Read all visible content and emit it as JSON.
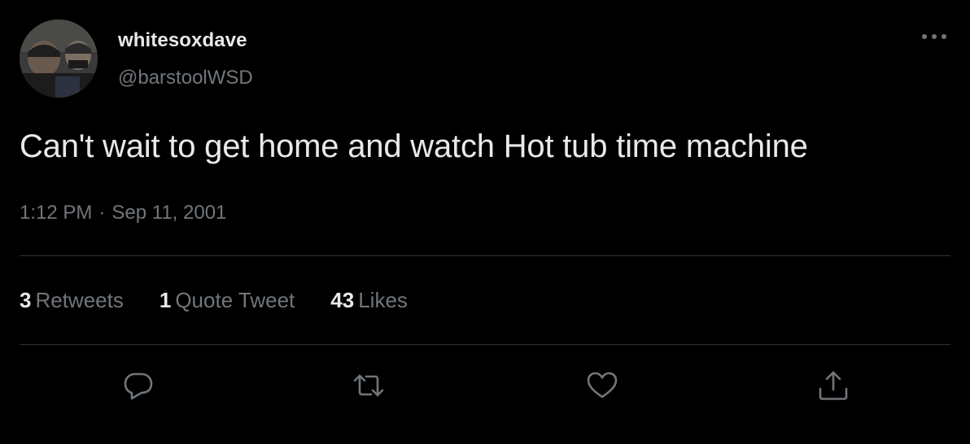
{
  "author": {
    "display_name": "whitesoxdave",
    "handle": "@barstoolWSD",
    "avatar_icon": "profile-photo"
  },
  "tweet": {
    "text": "Can't wait to get home and watch Hot tub time machine",
    "time": "1:12 PM",
    "separator": "·",
    "date": "Sep 11, 2001"
  },
  "stats": {
    "retweets": {
      "count": "3",
      "label": "Retweets"
    },
    "quotes": {
      "count": "1",
      "label": "Quote Tweet"
    },
    "likes": {
      "count": "43",
      "label": "Likes"
    }
  },
  "actions": {
    "reply_icon": "reply-icon",
    "retweet_icon": "retweet-icon",
    "like_icon": "heart-icon",
    "share_icon": "share-icon",
    "more_icon": "more-icon"
  },
  "colors": {
    "background": "#000000",
    "primary_text": "#e7e9ea",
    "secondary_text": "#71767b",
    "divider": "#2f3336"
  }
}
